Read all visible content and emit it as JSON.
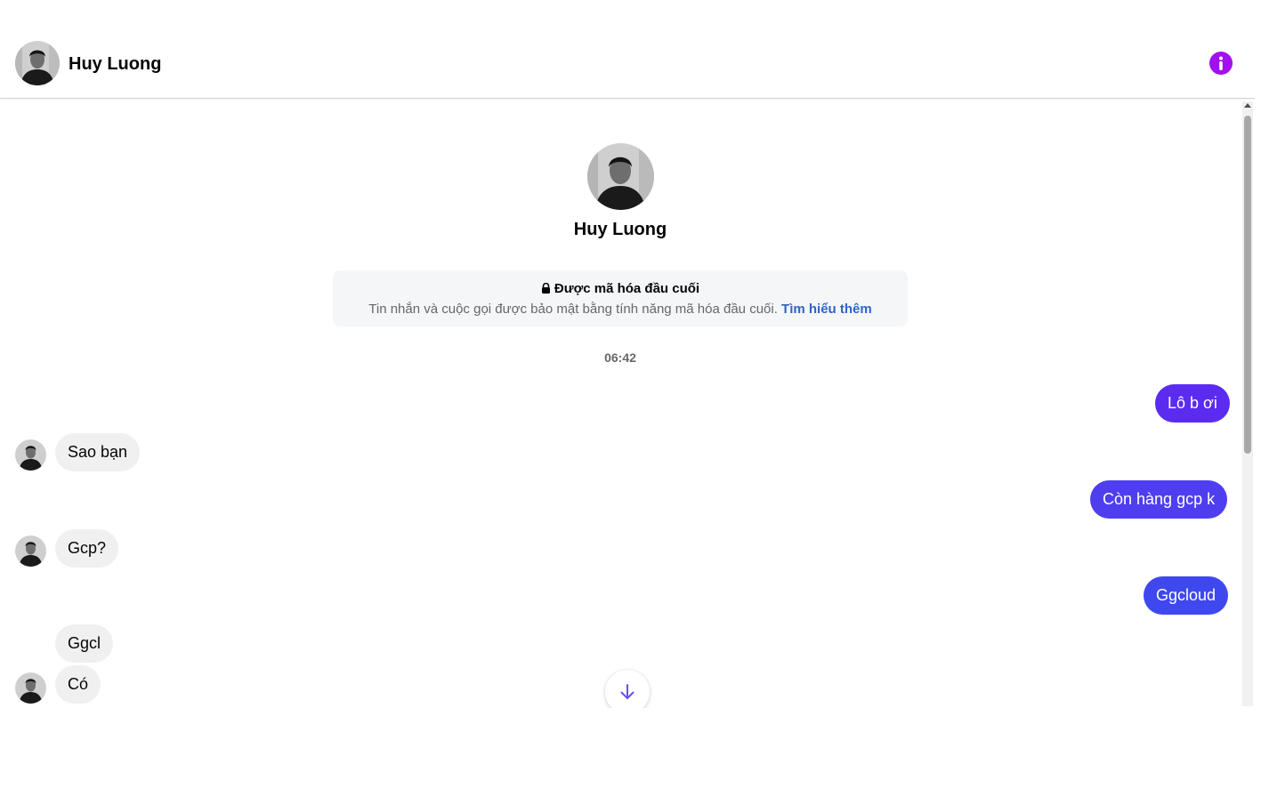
{
  "header": {
    "contact_name": "Huy Luong",
    "info_icon": "info-icon",
    "accent_color": "#a20ff0"
  },
  "profile": {
    "name": "Huy Luong"
  },
  "encryption_notice": {
    "icon": "lock-icon",
    "title": "Được mã hóa đầu cuối",
    "description": "Tin nhắn và cuộc gọi được bảo mật bằng tính năng mã hóa đầu cuối.",
    "link_text": "Tìm hiểu thêm",
    "link_color": "#2e64c9"
  },
  "conversation": {
    "timestamp": "06:42",
    "messages": [
      {
        "direction": "outgoing",
        "text": "Lô b ơi",
        "color": "#5b2cf0"
      },
      {
        "direction": "incoming",
        "text": "Sao bạn"
      },
      {
        "direction": "outgoing",
        "text": "Còn hàng gcp k",
        "color": "#4f3ef0"
      },
      {
        "direction": "incoming",
        "text": "Gcp?"
      },
      {
        "direction": "outgoing",
        "text": "Ggcloud",
        "color": "#3f48ee"
      },
      {
        "direction": "incoming",
        "text": "Ggcl"
      },
      {
        "direction": "incoming",
        "text": "Có"
      }
    ]
  },
  "scroll_down_icon": "arrow-down-icon",
  "scroll_down_color": "#6b4ef0"
}
